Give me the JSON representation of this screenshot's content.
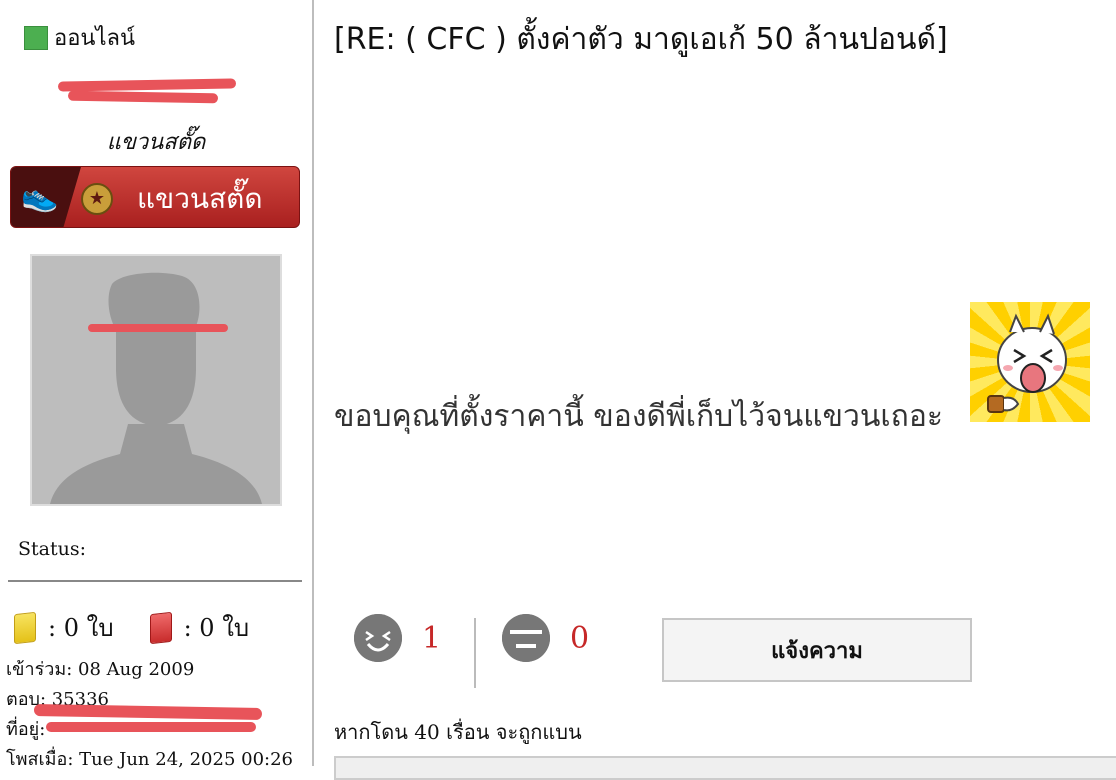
{
  "sidebar": {
    "online_label": "ออนไลน์",
    "username": "",
    "rank_title": "แขวนสตั๊ด",
    "rank_badge_label": "แขวนสตั๊ด",
    "status_label": "Status:",
    "cards": {
      "yellow": ": 0 ใบ",
      "red": ": 0 ใบ"
    },
    "joined_label": "เข้าร่วม",
    "joined_value": ": 08 Aug 2009",
    "replies_label": "ตอบ",
    "replies_value": ": 35336",
    "location_label": "ที่อยู่",
    "location_value": ":",
    "posted_label": "โพสเมื่อ",
    "posted_value": ": Tue Jun 24, 2025 00:26"
  },
  "post": {
    "title": "[RE: ( CFC ) ตั้งค่าตัว มาดูเอเก้ 50 ล้านปอนด์]",
    "body": "ขอบคุณที่ตั้งราคานี้ ของดีพี่เก็บไว้จนแขวนเถอะ"
  },
  "votes": {
    "up_count": "1",
    "down_count": "0"
  },
  "report_button": "แจ้งความ",
  "warning": {
    "prefix": "หากโดน",
    "count": "40",
    "suffix": "เรื่อน จะถูกแบน"
  },
  "icons": {
    "online": "online-status-icon",
    "up": "laugh-face-icon",
    "down": "sad-face-icon",
    "rank": "boot-icon",
    "star": "star-icon"
  },
  "colors": {
    "online": "#4caf50",
    "vote_count": "#c62828",
    "badge": "#b52a27",
    "redaction": "#e8545a"
  }
}
